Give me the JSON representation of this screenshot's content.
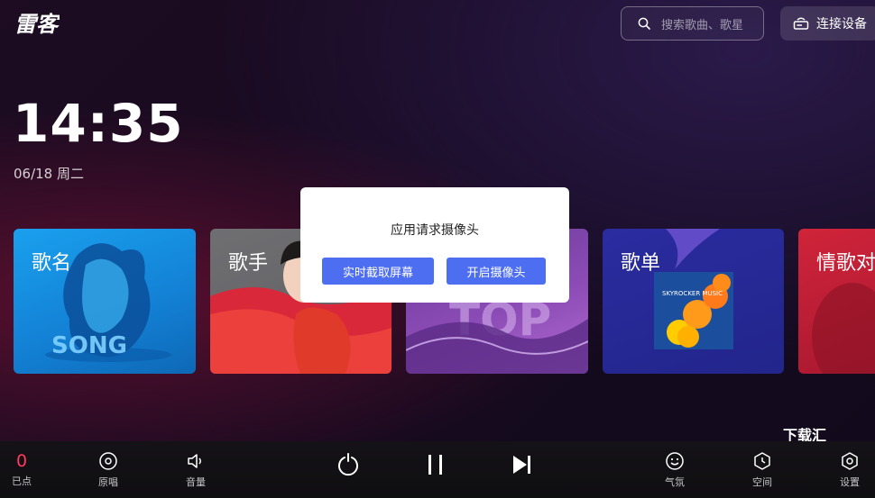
{
  "header": {
    "logo_text": "雷客",
    "search_placeholder": "搜索歌曲、歌星",
    "connect_label": "连接设备"
  },
  "clock": {
    "time": "14:35",
    "date": "06/18 周二"
  },
  "cards": [
    {
      "label": "歌名",
      "art_text": "SONG"
    },
    {
      "label": "歌手"
    },
    {
      "label": "",
      "art_text": "TOP"
    },
    {
      "label": "歌单",
      "art_text": "SKYROCKER MUSIC"
    },
    {
      "label": "情歌对"
    }
  ],
  "dialog": {
    "title": "应用请求摄像头",
    "button_screenshot": "实时截取屏幕",
    "button_camera": "开启摄像头"
  },
  "watermark": "下载汇",
  "bottom_bar": {
    "queued_count": "0",
    "queued_label": "已点",
    "original_label": "原唱",
    "volume_label": "音量",
    "atmosphere_label": "气氛",
    "space_label": "空间",
    "settings_label": "设置"
  },
  "colors": {
    "accent": "#4d6ef0",
    "count": "#ff3a5c"
  }
}
